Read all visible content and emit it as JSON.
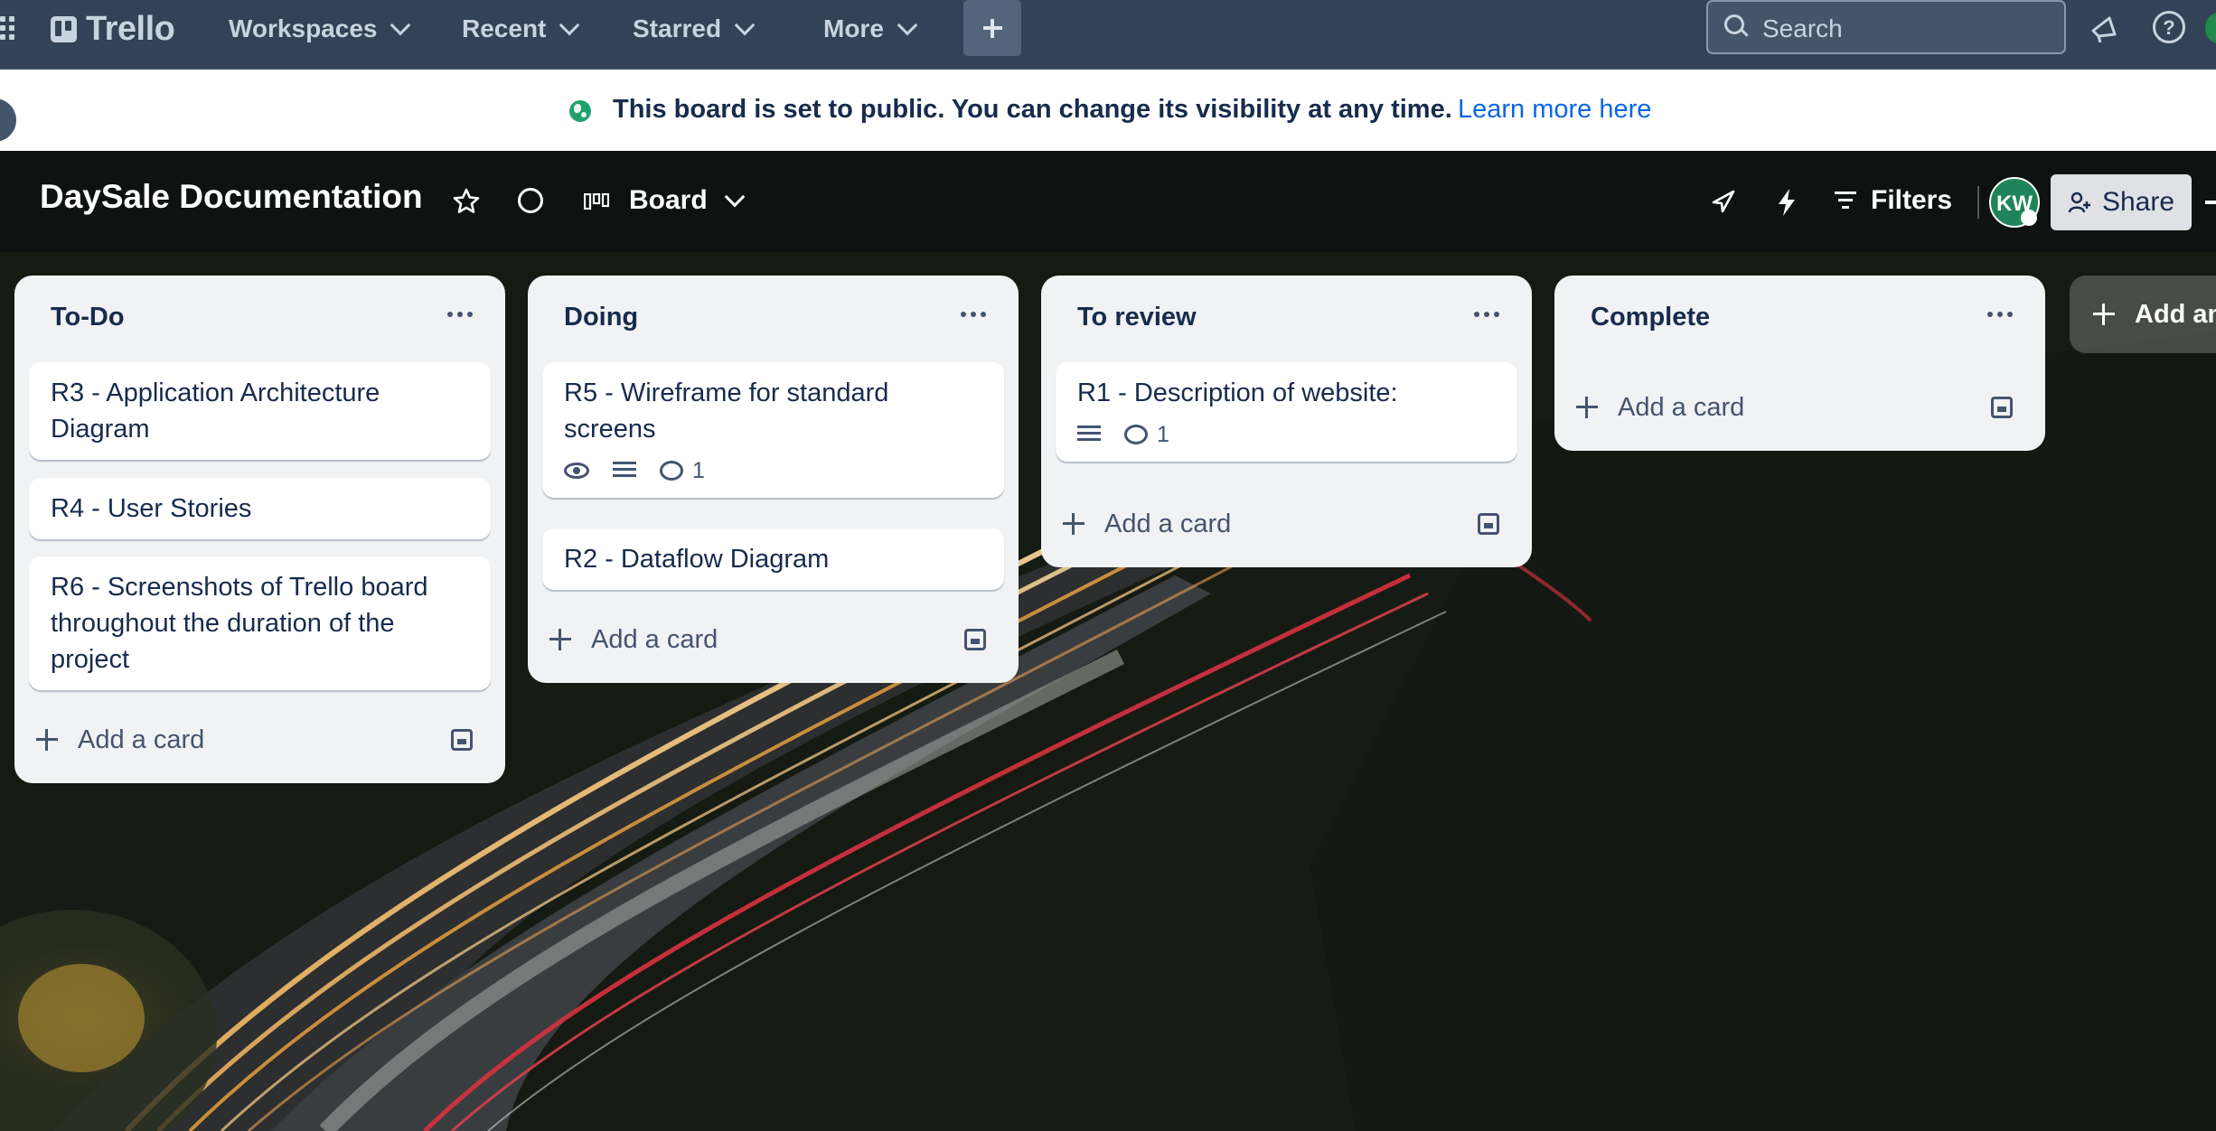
{
  "nav": {
    "logo": "Trello",
    "menus": [
      "Workspaces",
      "Recent",
      "Starred",
      "More"
    ],
    "search_placeholder": "Search"
  },
  "banner": {
    "message": "This board is set to public. You can change its visibility at any time.",
    "link": "Learn more here"
  },
  "board": {
    "title": "DaySale Documentation",
    "view": "Board",
    "filters": "Filters",
    "member_initials": "KW",
    "share": "Share"
  },
  "lists": [
    {
      "title": "To-Do",
      "add_card": "Add a card",
      "cards": [
        {
          "title": "R3 - Application Architecture Diagram"
        },
        {
          "title": "R4 - User Stories"
        },
        {
          "title": "R6 - Screenshots of Trello board throughout the duration of the project"
        }
      ]
    },
    {
      "title": "Doing",
      "add_card": "Add a card",
      "cards": [
        {
          "title": "R5 - Wireframe for standard screens",
          "badges": {
            "watch": true,
            "description": true,
            "comments": "1"
          }
        },
        {
          "title": "R2 - Dataflow Diagram"
        }
      ]
    },
    {
      "title": "To review",
      "add_card": "Add a card",
      "cards": [
        {
          "title": "R1 - Description of website:",
          "badges": {
            "description": true,
            "comments": "1"
          }
        }
      ]
    },
    {
      "title": "Complete",
      "add_card": "Add a card",
      "cards": []
    }
  ],
  "add_list": "Add an",
  "icons": [
    "apps-grid-icon",
    "trello-logo-icon",
    "plus-icon",
    "search-icon",
    "megaphone-icon",
    "help-icon",
    "globe-icon",
    "star-icon",
    "board-view-icon",
    "rocket-icon",
    "bolt-icon",
    "filter-icon",
    "share-icon",
    "ellipsis-icon",
    "eye-icon",
    "description-icon",
    "comment-icon",
    "template-icon"
  ],
  "colors": {
    "nav": "#334256",
    "banner_link": "#0c66e4",
    "public_globe": "#22a06b",
    "avatar": "#1f845a",
    "list_bg": "#f1f2f4"
  }
}
